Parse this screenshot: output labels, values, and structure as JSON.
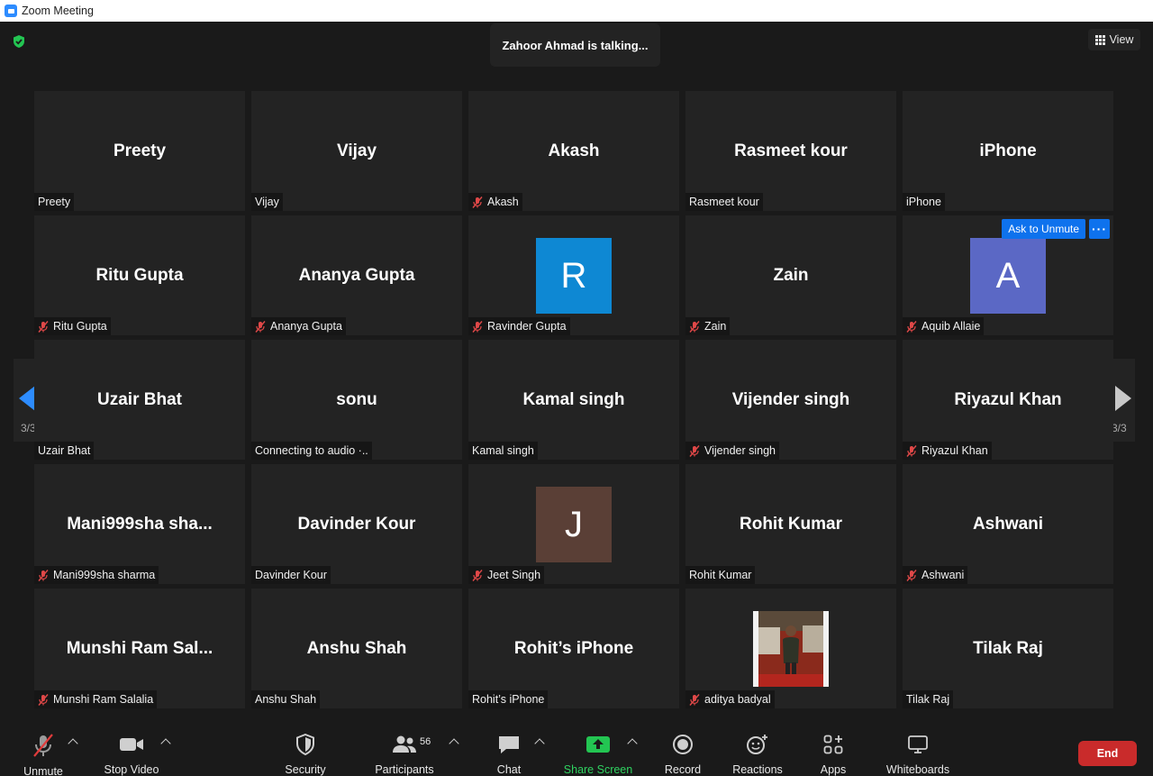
{
  "window": {
    "title": "Zoom Meeting"
  },
  "talking_indicator": "Zahoor Ahmad is talking...",
  "view_button": "View",
  "ask_to_unmute": "Ask to Unmute",
  "more_label": "···",
  "pagination": {
    "left": "3/3",
    "right": "3/3"
  },
  "participants": [
    {
      "display": "Preety",
      "name": "Preety",
      "muted": false
    },
    {
      "display": "Vijay",
      "name": "Vijay",
      "muted": false
    },
    {
      "display": "Akash",
      "name": "Akash",
      "muted": true
    },
    {
      "display": "Rasmeet kour",
      "name": "Rasmeet kour",
      "muted": false
    },
    {
      "display": "iPhone",
      "name": "iPhone",
      "muted": false
    },
    {
      "display": "Ritu Gupta",
      "name": "Ritu Gupta",
      "muted": true
    },
    {
      "display": "Ananya Gupta",
      "name": "Ananya Gupta",
      "muted": true
    },
    {
      "display": "",
      "name": "Ravinder Gupta",
      "muted": true,
      "avatar_letter": "R",
      "avatar_color": "#0e88d3"
    },
    {
      "display": "Zain",
      "name": "Zain",
      "muted": true
    },
    {
      "display": "",
      "name": "Aquib Allaie",
      "muted": true,
      "avatar_letter": "A",
      "avatar_color": "#5b68c5"
    },
    {
      "display": "Uzair Bhat",
      "name": "Uzair Bhat",
      "muted": false
    },
    {
      "display": "sonu",
      "name": "Connecting to audio ·..",
      "muted": false
    },
    {
      "display": "Kamal singh",
      "name": "Kamal singh",
      "muted": false
    },
    {
      "display": "Vijender singh",
      "name": "Vijender singh",
      "muted": true
    },
    {
      "display": "Riyazul Khan",
      "name": "Riyazul Khan",
      "muted": true
    },
    {
      "display": "Mani999sha  sha...",
      "name": "Mani999sha sharma",
      "muted": true
    },
    {
      "display": "Davinder Kour",
      "name": "Davinder Kour",
      "muted": false
    },
    {
      "display": "",
      "name": "Jeet Singh",
      "muted": true,
      "avatar_letter": "J",
      "avatar_color": "#5a3f36"
    },
    {
      "display": "Rohit Kumar",
      "name": "Rohit Kumar",
      "muted": false
    },
    {
      "display": "Ashwani",
      "name": "Ashwani",
      "muted": true
    },
    {
      "display": "Munshi  Ram  Sal...",
      "name": "Munshi Ram Salalia",
      "muted": true
    },
    {
      "display": "Anshu Shah",
      "name": "Anshu Shah",
      "muted": false
    },
    {
      "display": "Rohit’s iPhone",
      "name": "Rohit’s iPhone",
      "muted": false
    },
    {
      "display": "",
      "name": "aditya badyal",
      "muted": true,
      "photo": true
    },
    {
      "display": "Tilak   Raj",
      "name": "Tilak   Raj",
      "muted": false
    }
  ],
  "toolbar": {
    "unmute": "Unmute",
    "stop_video": "Stop Video",
    "security": "Security",
    "participants": "Participants",
    "participants_count": "56",
    "chat": "Chat",
    "share_screen": "Share Screen",
    "record": "Record",
    "reactions": "Reactions",
    "apps": "Apps",
    "whiteboards": "Whiteboards",
    "end": "End"
  },
  "colors": {
    "accent": "#0e72ed",
    "share_green": "#23c552",
    "end_red": "#c92b2b",
    "tile_bg": "#232323"
  }
}
